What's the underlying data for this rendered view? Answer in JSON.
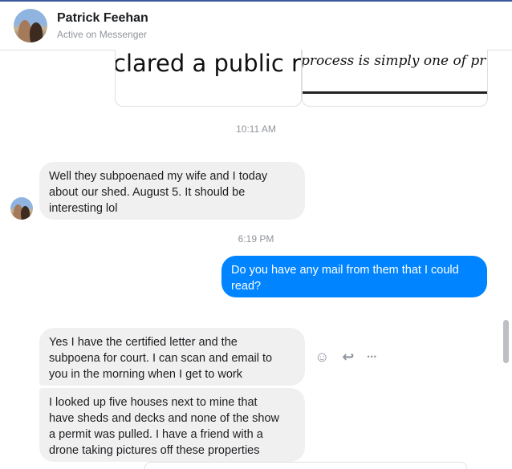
{
  "header": {
    "name": "Patrick Feehan",
    "status": "Active on Messenger"
  },
  "previews": [
    {
      "text": "clared a public r"
    },
    {
      "text": "process is simply one of pr"
    }
  ],
  "messages": {
    "time1": "10:11 AM",
    "in1": [
      "Well they subpoenaed my wife and I today",
      "about our shed. August 5.  It should be",
      "interesting lol"
    ],
    "time2": "6:19 PM",
    "out1": [
      "Do you have any mail from them that I could",
      "read?"
    ],
    "in2": [
      "Yes I have the certified letter and the",
      "subpoena for court. I can scan and email to",
      "you in the morning when I get to work"
    ],
    "in3": [
      "I looked up five houses next to mine that",
      "have sheds and decks and none of the show",
      "a permit was pulled. I have a friend with a",
      "drone taking pictures off these properties"
    ]
  },
  "actions": {
    "react_icon": "smiley-icon",
    "reply_icon": "reply-icon",
    "more_icon": "more-icon",
    "react": "☺",
    "reply": "↩",
    "more": "•••"
  }
}
